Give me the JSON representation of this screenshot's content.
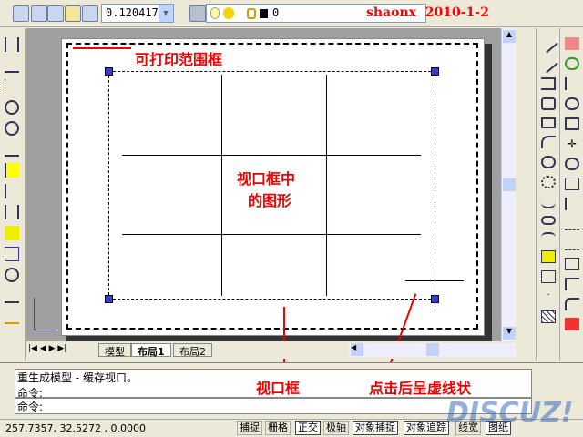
{
  "toolbar": {
    "scale_value": "0.120417",
    "layer_value": "0",
    "watermark": "shaonx  2010-1-2"
  },
  "annotations": {
    "printable_area": "可打印范围框",
    "viewport_content_1": "视口框中",
    "viewport_content_2": "的图形",
    "viewport_frame": "视口框",
    "click_dashed": "点击后呈虚线状"
  },
  "tabs": [
    {
      "label": "模型"
    },
    {
      "label": "布局1"
    },
    {
      "label": "布局2"
    }
  ],
  "command": {
    "history_1": "重生成模型 - 缓存视口。",
    "history_2": "命令:",
    "prompt": "命令:"
  },
  "status": {
    "coords": "257.7357, 32.5272 , 0.0000",
    "buttons": [
      "捕捉",
      "栅格",
      "正交",
      "极轴",
      "对象捕捉",
      "对象追踪",
      "线宽",
      "图纸"
    ]
  },
  "logo": "DISCUZ!",
  "colors": {
    "annotation": "#ff0000",
    "paper": "#ffffff",
    "canvas": "#a0a0a0",
    "grip": "#3c3cc8"
  }
}
